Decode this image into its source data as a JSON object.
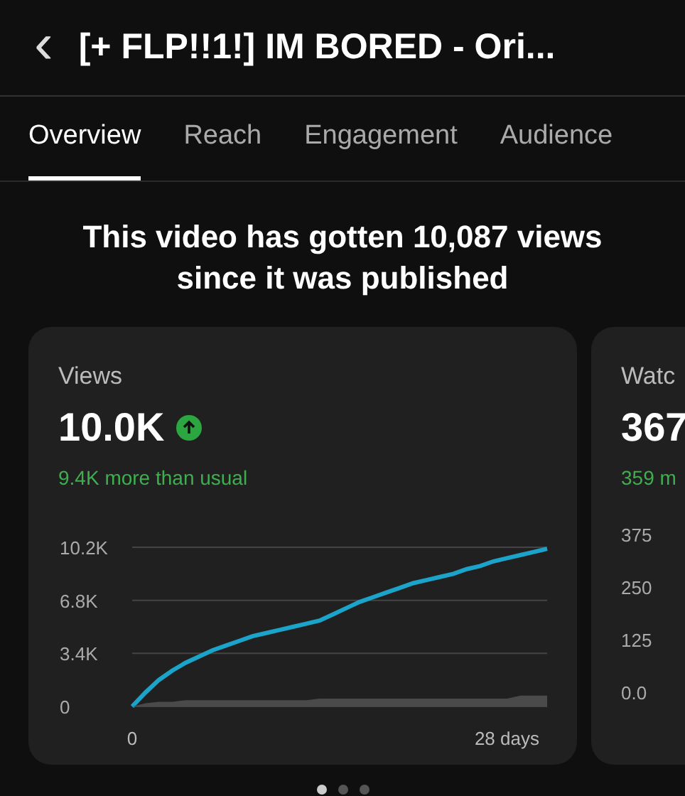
{
  "header": {
    "back_icon": "‹",
    "title": "[+ FLP!!1!] IM BORED - Ori..."
  },
  "tabs": [
    {
      "label": "Overview",
      "selected": true
    },
    {
      "label": "Reach",
      "selected": false
    },
    {
      "label": "Engagement",
      "selected": false
    },
    {
      "label": "Audience",
      "selected": false
    }
  ],
  "headline": "This video has gotten 10,087 views since it was published",
  "cards": [
    {
      "title": "Views",
      "value": "10.0K",
      "trend_up": true,
      "comparison": "9.4K more than usual",
      "chart_data": {
        "type": "line",
        "x": [
          0,
          1,
          2,
          3,
          4,
          5,
          6,
          7,
          8,
          9,
          10,
          11,
          12,
          13,
          14,
          15,
          16,
          17,
          18,
          19,
          20,
          21,
          22,
          23,
          24,
          25,
          26,
          27,
          28,
          29,
          30,
          31
        ],
        "xlim": [
          0,
          31
        ],
        "xticks": [
          {
            "value": 0,
            "label": "0"
          },
          {
            "value": 28,
            "label": "28 days"
          }
        ],
        "yticks": [
          {
            "value": 0,
            "label": "0"
          },
          {
            "value": 3400,
            "label": "3.4K"
          },
          {
            "value": 6800,
            "label": "6.8K"
          },
          {
            "value": 10200,
            "label": "10.2K"
          }
        ],
        "ylim": [
          0,
          10200
        ],
        "series": [
          {
            "type": "line",
            "color": "#1ba3c9",
            "values": [
              0,
              900,
              1700,
              2300,
              2800,
              3200,
              3600,
              3900,
              4200,
              4500,
              4700,
              4900,
              5100,
              5300,
              5500,
              5900,
              6300,
              6700,
              7000,
              7300,
              7600,
              7900,
              8100,
              8300,
              8500,
              8800,
              9000,
              9300,
              9500,
              9700,
              9900,
              10100
            ]
          },
          {
            "type": "area",
            "color": "#4a4a4a",
            "values": [
              0,
              200,
              300,
              300,
              400,
              400,
              400,
              400,
              400,
              400,
              400,
              400,
              400,
              400,
              500,
              500,
              500,
              500,
              500,
              500,
              500,
              500,
              500,
              500,
              500,
              500,
              500,
              500,
              500,
              700,
              700,
              700
            ]
          }
        ]
      }
    },
    {
      "title": "Watc",
      "value": "367",
      "comparison": "359 m",
      "axis_labels": [
        "375",
        "250",
        "125",
        "0.0"
      ]
    }
  ],
  "pager_dots": [
    {
      "selected": true
    },
    {
      "selected": false
    },
    {
      "selected": false
    }
  ]
}
